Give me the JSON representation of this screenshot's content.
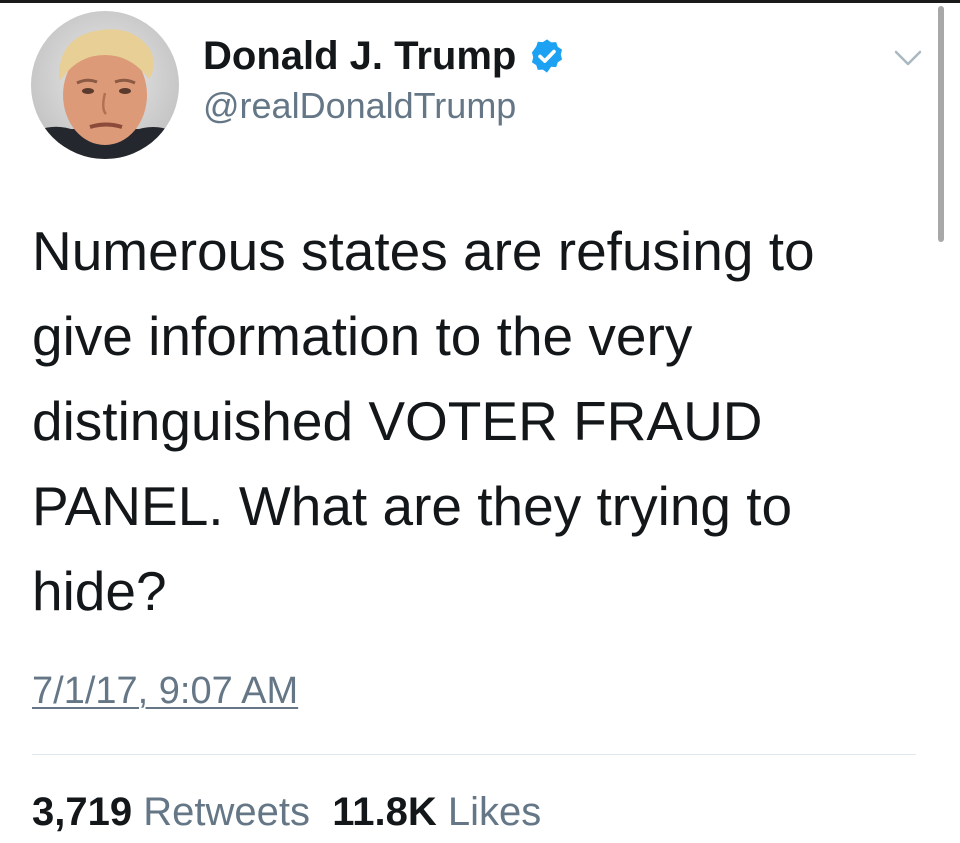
{
  "author": {
    "display_name": "Donald J. Trump",
    "handle": "@realDonaldTrump",
    "verified": true,
    "verified_color": "#1da1f2"
  },
  "tweet": {
    "text": "Numerous states are refusing to\ngive information to the very\ndistinguished VOTER FRAUD\nPANEL. What are they trying to\nhide?",
    "timestamp": "7/1/17, 9:07 AM"
  },
  "stats": {
    "retweets_count": "3,719",
    "retweets_label": "Retweets",
    "likes_count": "11.8K",
    "likes_label": "Likes"
  },
  "icons": {
    "menu": "chevron-down-icon",
    "verified": "verified-badge-icon"
  }
}
